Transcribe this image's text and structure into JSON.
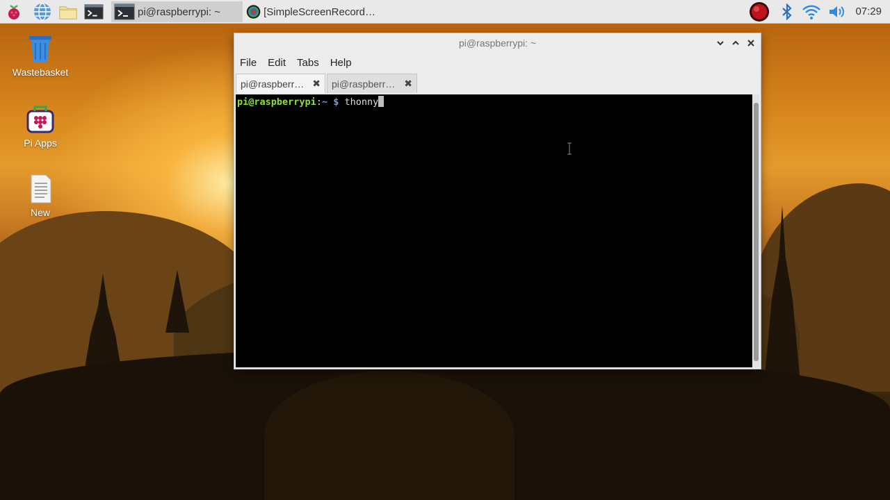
{
  "taskbar": {
    "tasks": [
      {
        "label": "pi@raspberrypi: ~",
        "active": true
      },
      {
        "label": "[SimpleScreenRecord…",
        "active": false
      }
    ],
    "clock": "07:29"
  },
  "desktop": {
    "icons": [
      {
        "label": "Wastebasket",
        "icon": "trash-icon"
      },
      {
        "label": "Pi Apps",
        "icon": "pi-apps-icon"
      },
      {
        "label": "New",
        "icon": "document-icon"
      }
    ]
  },
  "window": {
    "title": "pi@raspberrypi: ~",
    "menu": [
      "File",
      "Edit",
      "Tabs",
      "Help"
    ],
    "tabs": [
      {
        "label": "pi@raspberr…",
        "active": true
      },
      {
        "label": "pi@raspberr…",
        "active": false
      }
    ],
    "terminal": {
      "user_host": "pi@raspberrypi",
      "separator": ":",
      "path": "~",
      "prompt_symbol": " $ ",
      "command": "thonny"
    }
  },
  "colors": {
    "prompt_user": "#8ae234",
    "prompt_path": "#729fcf",
    "terminal_bg": "#000000",
    "taskbar_bg": "#e9e9e9"
  }
}
